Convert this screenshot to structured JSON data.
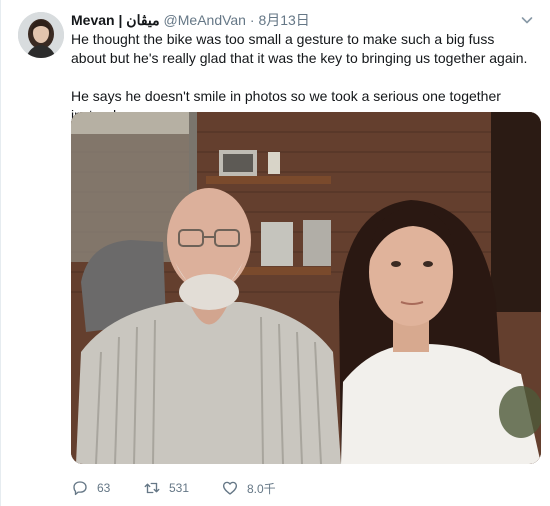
{
  "tweet": {
    "display_name": "Mevan",
    "separator": "|",
    "display_name_alt": "میڤان",
    "handle": "@MeAndVan",
    "date_dot": "·",
    "date": "8月13日",
    "paragraphs": [
      "He thought the bike was too small a gesture to make such a big fuss about but he's really glad that it was the key to bringing us together again.",
      "He says he doesn't smile in photos so we took a serious one together instead."
    ]
  },
  "actions": {
    "reply_count": "63",
    "retweet_count": "531",
    "like_count": "8.0千"
  },
  "icons": {
    "reply": "reply-icon",
    "retweet": "retweet-icon",
    "like": "heart-icon",
    "menu": "chevron-down-icon"
  },
  "colors": {
    "text_primary": "#14171a",
    "text_secondary": "#657786",
    "divider": "#e6ecf0"
  }
}
